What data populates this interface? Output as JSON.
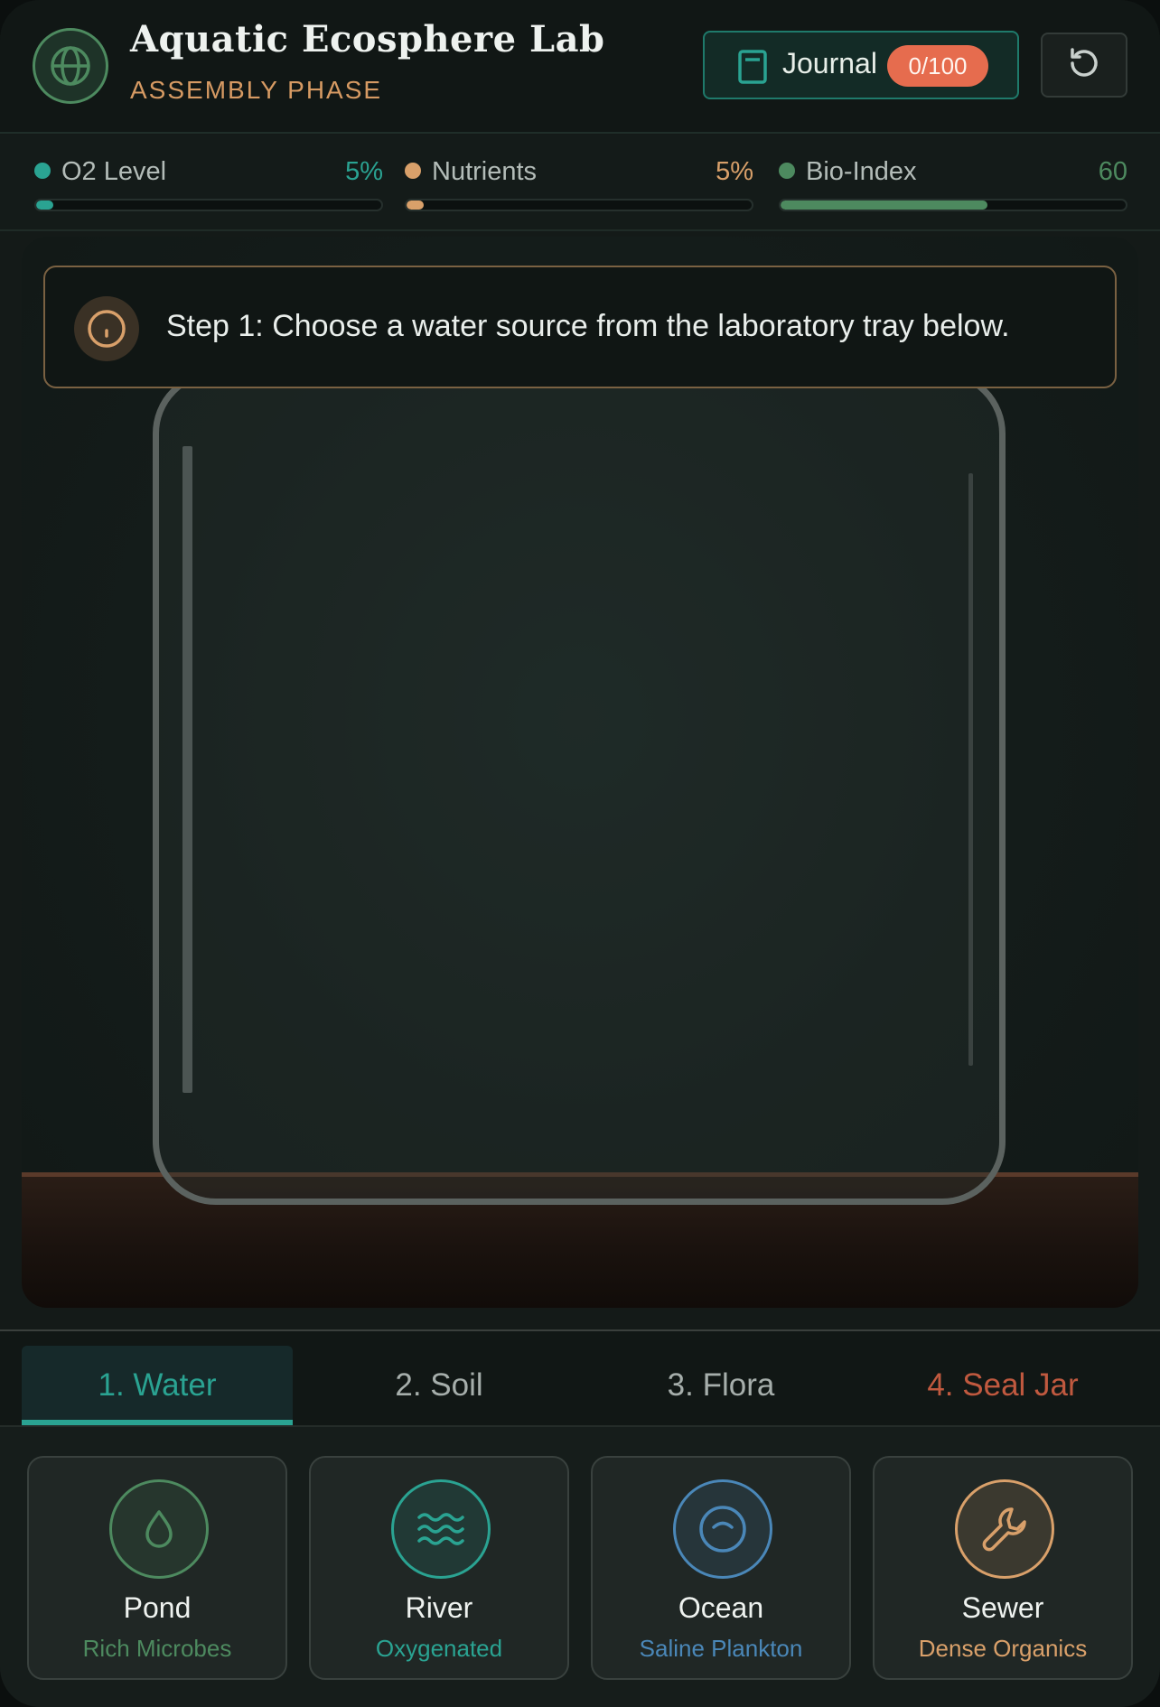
{
  "header": {
    "title": "Aquatic Ecosphere Lab",
    "phase": "ASSEMBLY PHASE",
    "logo_icon": "globe-icon",
    "journal": {
      "label": "Journal",
      "count": "0/100",
      "icon": "book-icon"
    },
    "reset_icon": "rotate-ccw-icon"
  },
  "stats": [
    {
      "label": "O2 Level",
      "value": "5%",
      "level": 0.05,
      "color": "#2aa392"
    },
    {
      "label": "Nutrients",
      "value": "5%",
      "level": 0.05,
      "color": "#d9a06a"
    },
    {
      "label": "Bio-Index",
      "value": "60",
      "level": 0.6,
      "color": "#4d8a5f"
    }
  ],
  "instruction": {
    "text": "Step 1: Choose a water source from the laboratory tray below.",
    "icon": "info-icon"
  },
  "tabs": [
    {
      "label": "1. Water",
      "active": true,
      "color": "#2aa392"
    },
    {
      "label": "2. Soil",
      "active": false,
      "color": "#a6aeab"
    },
    {
      "label": "3. Flora",
      "active": false,
      "color": "#a6aeab"
    },
    {
      "label": "4. Seal Jar",
      "active": false,
      "color": "#c0593f"
    }
  ],
  "cards": [
    {
      "name": "Pond",
      "desc": "Rich Microbes",
      "icon": "droplet-icon",
      "accent": "#4d8a5f"
    },
    {
      "name": "River",
      "desc": "Oxygenated",
      "icon": "waves-icon",
      "accent": "#2aa392"
    },
    {
      "name": "Ocean",
      "desc": "Saline Plankton",
      "icon": "ocean-icon",
      "accent": "#4a87b8"
    },
    {
      "name": "Sewer",
      "desc": "Dense Organics",
      "icon": "wrench-icon",
      "accent": "#d9a06a"
    }
  ]
}
